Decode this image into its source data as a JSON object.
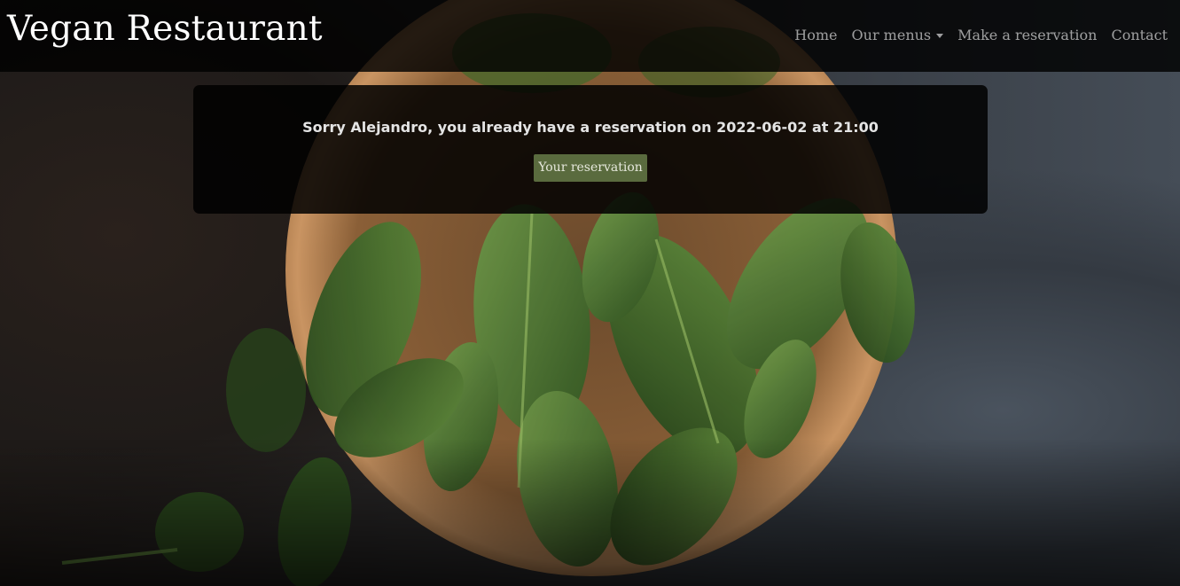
{
  "navbar": {
    "brand": "Vegan Restaurant",
    "links": {
      "home": "Home",
      "menus": "Our menus",
      "reservation": "Make a reservation",
      "contact": "Contact"
    }
  },
  "alert": {
    "message": "Sorry Alejandro, you already have a reservation on 2022-06-02 at 21:00",
    "button_label": "Your reservation"
  },
  "colors": {
    "button_bg": "#5a6b3e",
    "navbar_bg": "#000000"
  }
}
